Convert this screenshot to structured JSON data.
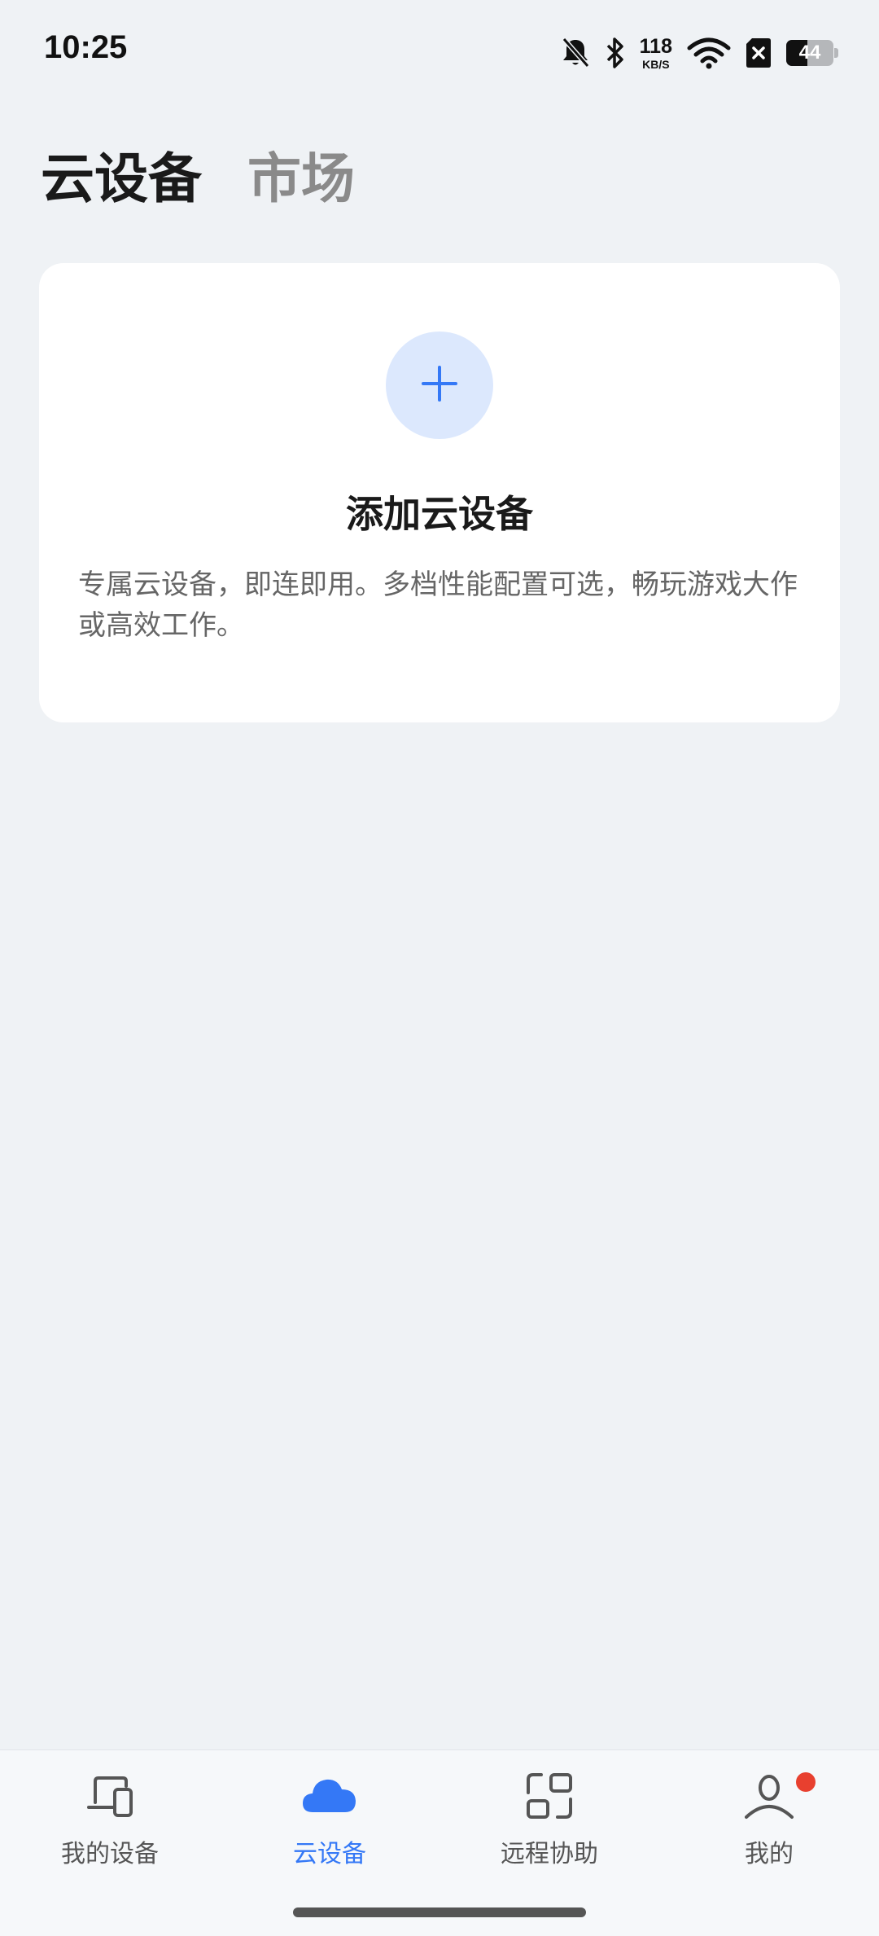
{
  "status_bar": {
    "time": "10:25",
    "net_speed_value": "118",
    "net_speed_unit": "KB/S",
    "battery_level": "44",
    "battery_fraction": 0.44,
    "icons": [
      "bell-off-icon",
      "bluetooth-icon",
      "wifi-icon",
      "sim-error-icon",
      "battery-icon"
    ]
  },
  "top_tabs": [
    {
      "label": "云设备",
      "active": true
    },
    {
      "label": "市场",
      "active": false
    }
  ],
  "add_card": {
    "icon": "plus-icon",
    "title": "添加云设备",
    "description": "专属云设备，即连即用。多档性能配置可选，畅玩游戏大作或高效工作。"
  },
  "bottom_nav": [
    {
      "label": "我的设备",
      "icon": "devices-icon",
      "active": false
    },
    {
      "label": "云设备",
      "icon": "cloud-icon",
      "active": true
    },
    {
      "label": "远程协助",
      "icon": "remote-assist-icon",
      "active": false
    },
    {
      "label": "我的",
      "icon": "person-icon",
      "active": false,
      "badge": true
    }
  ],
  "colors": {
    "background": "#eff2f5",
    "accent": "#3478f6",
    "accent_light": "#dce8fd",
    "badge": "#e8402f"
  }
}
